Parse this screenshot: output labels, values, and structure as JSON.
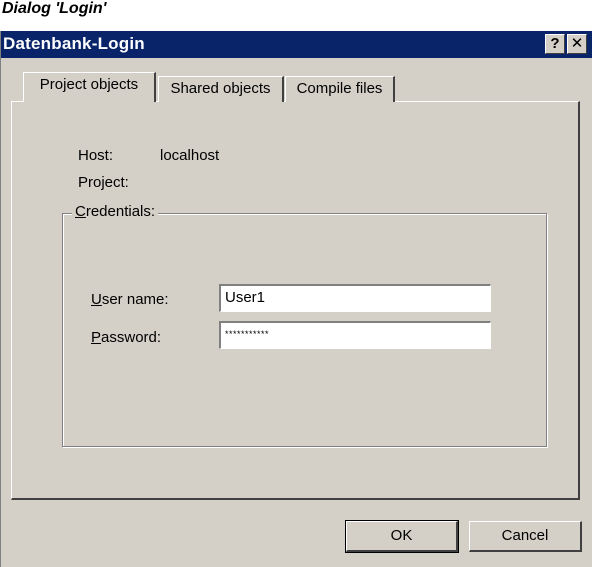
{
  "caption": "Dialog 'Login'",
  "window": {
    "title": "Datenbank-Login",
    "help_label": "?",
    "close_label": "✕"
  },
  "tabs": [
    {
      "label": "Project objects",
      "active": true
    },
    {
      "label": "Shared objects",
      "active": false
    },
    {
      "label": "Compile files",
      "active": false
    }
  ],
  "info": {
    "host_label": "Host:",
    "host_value": "localhost",
    "project_label": "Project:",
    "project_value": ""
  },
  "credentials": {
    "legend": "Credentials:",
    "user_label": "User name:",
    "user_value": "User1",
    "password_label": "Password:",
    "password_value": "***********"
  },
  "buttons": {
    "ok": "OK",
    "cancel": "Cancel"
  },
  "colors": {
    "titlebar": "#0a246a",
    "face": "#d4d0c8"
  }
}
